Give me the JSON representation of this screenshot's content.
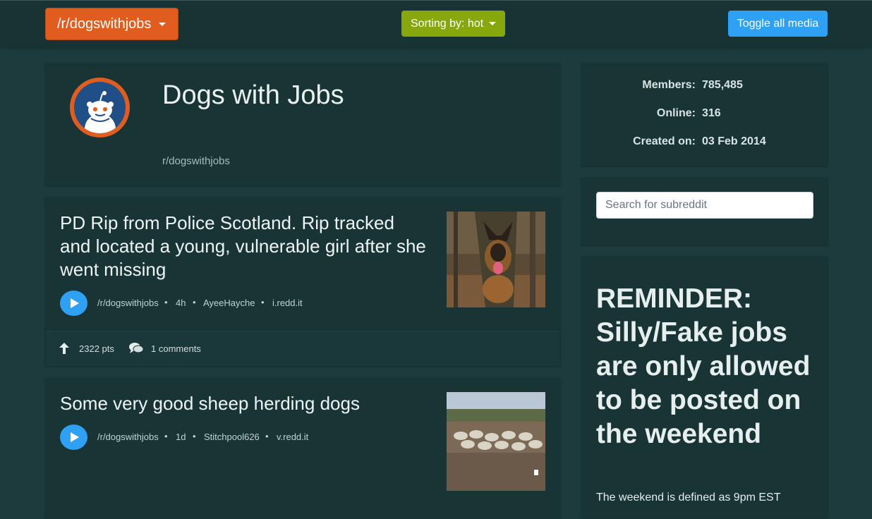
{
  "nav": {
    "subreddit_button": "/r/dogswithjobs",
    "sort_button": "Sorting by: hot",
    "toggle_media_button": "Toggle all media"
  },
  "subreddit": {
    "title": "Dogs with Jobs",
    "name": "r/dogswithjobs",
    "avatar_icon": "reddit-alien-icon"
  },
  "stats": {
    "members_label": "Members:",
    "members_value": "785,485",
    "online_label": "Online:",
    "online_value": "316",
    "created_label": "Created on:",
    "created_value": "03 Feb 2014"
  },
  "search": {
    "placeholder": "Search for subreddit"
  },
  "sidebar": {
    "reminder_title": "REMINDER: Silly/Fake jobs are only allowed to be posted on the weekend",
    "reminder_text": "The weekend is defined as 9pm EST"
  },
  "posts": [
    {
      "title": "PD Rip from Police Scotland. Rip tracked and located a young, vulnerable girl after she went missing",
      "subreddit": "/r/dogswithjobs",
      "age": "4h",
      "author": "AyeeHayche",
      "domain": "i.redd.it",
      "points": "2322 pts",
      "comments": "1 comments",
      "separator": "•"
    },
    {
      "title": "Some very good sheep herding dogs",
      "subreddit": "/r/dogswithjobs",
      "age": "1d",
      "author": "Stitchpool626",
      "domain": "v.redd.it",
      "separator": "•"
    }
  ],
  "colors": {
    "background": "#1d3b3c",
    "card": "#183435",
    "orange": "#e05d1f",
    "green": "#86a80c",
    "blue": "#2ea1f5"
  }
}
